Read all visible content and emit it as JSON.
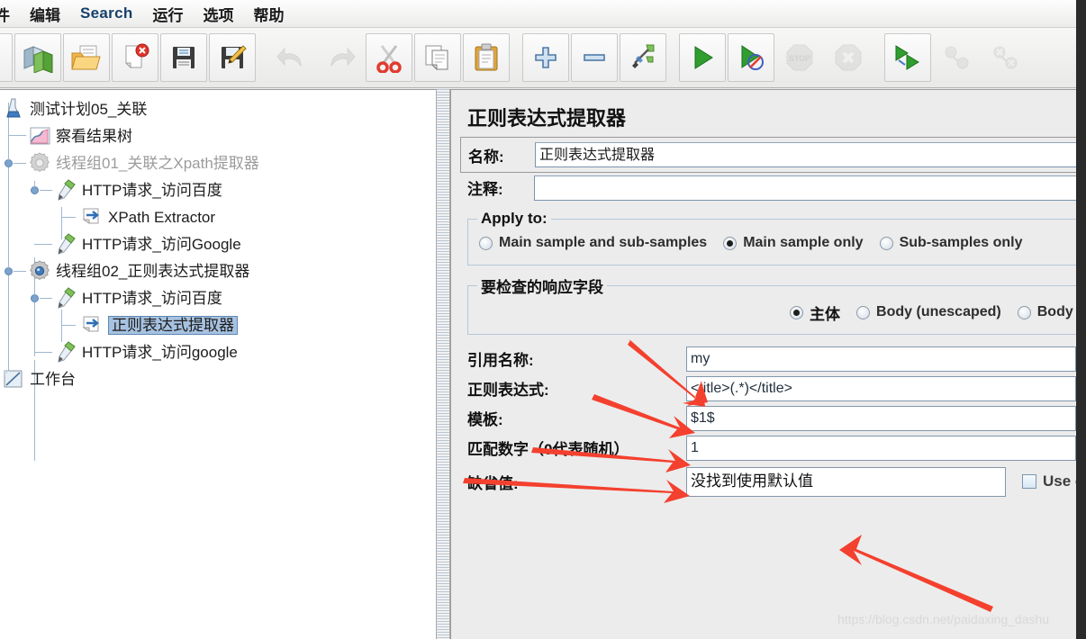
{
  "menu": {
    "items": [
      {
        "label": "件",
        "clipped": true,
        "latin": false
      },
      {
        "label": "编辑",
        "clipped": false,
        "latin": false
      },
      {
        "label": "Search",
        "clipped": false,
        "latin": true
      },
      {
        "label": "运行",
        "clipped": false,
        "latin": false
      },
      {
        "label": "选项",
        "clipped": false,
        "latin": false
      },
      {
        "label": "帮助",
        "clipped": false,
        "latin": false
      }
    ]
  },
  "toolbar": {
    "buttons": [
      {
        "icon": "new-testplan-icon",
        "enabled": true
      },
      {
        "icon": "templates-icon",
        "enabled": true
      },
      {
        "icon": "open-folder-icon",
        "enabled": true
      },
      {
        "icon": "close-document-icon",
        "enabled": true
      },
      {
        "icon": "save-icon",
        "enabled": true
      },
      {
        "icon": "save-as-icon",
        "enabled": true
      },
      {
        "icon": "undo-icon",
        "enabled": false
      },
      {
        "icon": "redo-icon",
        "enabled": false
      },
      {
        "icon": "cut-scissors-icon",
        "enabled": true
      },
      {
        "icon": "copy-icon",
        "enabled": true
      },
      {
        "icon": "paste-clipboard-icon",
        "enabled": true
      },
      {
        "icon": "expand-all-plus-icon",
        "enabled": true
      },
      {
        "icon": "collapse-all-minus-icon",
        "enabled": true
      },
      {
        "icon": "toggle-icon",
        "enabled": true
      },
      {
        "icon": "start-play-icon",
        "enabled": true
      },
      {
        "icon": "start-no-pauses-icon",
        "enabled": true
      },
      {
        "icon": "stop-icon",
        "enabled": false
      },
      {
        "icon": "shutdown-icon",
        "enabled": false
      },
      {
        "icon": "start-remote-all-icon",
        "enabled": true
      },
      {
        "icon": "stop-remote-all-icon",
        "enabled": false
      },
      {
        "icon": "shutdown-remote-all-icon",
        "enabled": false
      }
    ]
  },
  "tree": {
    "nodes": [
      {
        "label": "测试计划05_关联",
        "icon": "test-plan-icon",
        "indent": 0,
        "muted": false,
        "selected": false
      },
      {
        "label": "察看结果树",
        "icon": "view-results-tree-icon",
        "indent": 1,
        "muted": false,
        "selected": false
      },
      {
        "label": "线程组01_关联之Xpath提取器",
        "icon": "thread-group-disabled-icon",
        "indent": 1,
        "muted": true,
        "selected": false
      },
      {
        "label": "HTTP请求_访问百度",
        "icon": "http-request-icon",
        "indent": 2,
        "muted": false,
        "selected": false
      },
      {
        "label": "XPath Extractor",
        "icon": "post-processor-icon",
        "indent": 3,
        "muted": false,
        "selected": false
      },
      {
        "label": "HTTP请求_访问Google",
        "icon": "http-request-icon",
        "indent": 2,
        "muted": false,
        "selected": false
      },
      {
        "label": "线程组02_正则表达式提取器",
        "icon": "thread-group-icon",
        "indent": 1,
        "muted": false,
        "selected": false
      },
      {
        "label": "HTTP请求_访问百度",
        "icon": "http-request-icon",
        "indent": 2,
        "muted": false,
        "selected": false
      },
      {
        "label": "正则表达式提取器",
        "icon": "post-processor-icon",
        "indent": 3,
        "muted": false,
        "selected": true
      },
      {
        "label": "HTTP请求_访问google",
        "icon": "http-request-icon",
        "indent": 2,
        "muted": false,
        "selected": false
      },
      {
        "label": "工作台",
        "icon": "workbench-icon",
        "indent": 0,
        "muted": false,
        "selected": false
      }
    ]
  },
  "detail": {
    "title": "正则表达式提取器",
    "name_label": "名称:",
    "name_value": "正则表达式提取器",
    "comment_label": "注释:",
    "comment_value": "",
    "apply_to": {
      "legend": "Apply to:",
      "options": [
        {
          "label": "Main sample and sub-samples",
          "selected": false
        },
        {
          "label": "Main sample only",
          "selected": true
        },
        {
          "label": "Sub-samples only",
          "selected": false
        }
      ]
    },
    "field_to_check": {
      "legend": "要检查的响应字段",
      "options": [
        {
          "label": "主体",
          "selected": true,
          "cn": true
        },
        {
          "label": "Body (unescaped)",
          "selected": false,
          "cn": false
        },
        {
          "label": "Body as a Document",
          "selected": false,
          "cn": false
        }
      ]
    },
    "fields": [
      {
        "label": "引用名称:",
        "value": "my",
        "name": "reference-name"
      },
      {
        "label": "正则表达式:",
        "value": "<title>(.*)</title>",
        "name": "regular-expression"
      },
      {
        "label": "模板:",
        "value": "$1$",
        "name": "template"
      },
      {
        "label": "匹配数字（0代表随机）",
        "value": "1",
        "name": "match-number"
      }
    ],
    "default_field": {
      "label": "缺省值:",
      "value": "没找到使用默认值",
      "checkbox_label": "Use empty default value",
      "checked": false
    }
  },
  "watermark": {
    "text": "https://blog.csdn.net/paidaxing_dashu"
  },
  "colors": {
    "accent_blue": "#17406b",
    "selection_bg": "#a7c2e0",
    "selection_border": "#5d87b5",
    "arrow_red": "#f4402e",
    "panel_bg": "#ececec",
    "tree_bg": "#ffffff",
    "edge_strip": "#2b2b2b"
  }
}
